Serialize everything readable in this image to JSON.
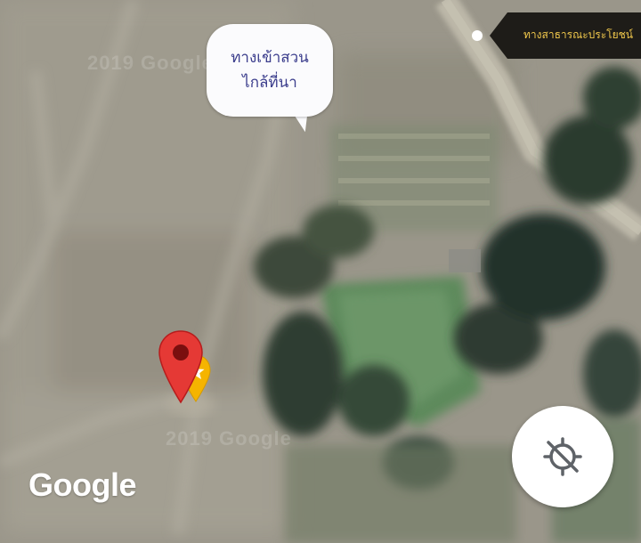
{
  "map": {
    "type": "satellite",
    "watermark": "2019 Google",
    "callout": {
      "line1": "ทางเข้าสวน",
      "line2": "ไกล้ที่นา"
    },
    "poi": {
      "label": "ทางสาธารณะประโยชน์",
      "label_color": "#f2c94c",
      "dot_color": "#ffffff"
    },
    "marker": {
      "color": "#e53935",
      "icon": "map-pin-icon"
    },
    "saved_marker": {
      "color": "#f5b400",
      "icon": "starred-place-icon"
    },
    "logo": "Google",
    "controls": {
      "locate_icon": "location-disabled-icon"
    }
  }
}
